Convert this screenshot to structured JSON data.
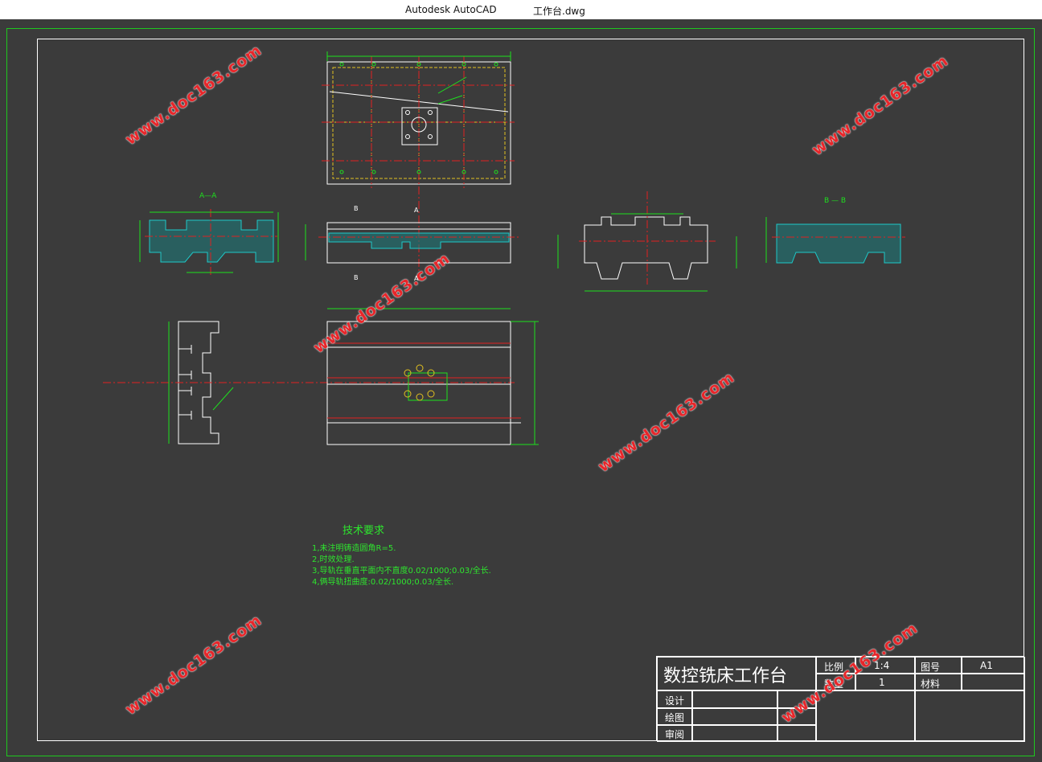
{
  "titlebar": {
    "app_name": "Autodesk AutoCAD",
    "file_name": "工作台.dwg"
  },
  "drawing": {
    "section_labels": {
      "aa": "A—A",
      "bb": "B — B",
      "a": "A",
      "b": "B"
    }
  },
  "technical_requirements": {
    "title": "技术要求",
    "items": [
      "1,未注明铸造圆角R=5.",
      "2,时效处理.",
      "3,导轨在垂直平面内不直度0.02/1000;0.03/全长.",
      "4,俩导轨扭曲度:0.02/1000;0.03/全长."
    ]
  },
  "title_block": {
    "part_name": "数控铣床工作台",
    "scale_label": "比例",
    "scale_value": "1:4",
    "drawing_no_label": "图号",
    "drawing_no_value": "A1",
    "quantity_label": "数量",
    "quantity_value": "1",
    "material_label": "材料",
    "material_value": "",
    "design_label": "设计",
    "draw_label": "绘图",
    "review_label": "审阅"
  },
  "watermark": {
    "text": "www.doc163.com"
  },
  "colors": {
    "background": "#3b3b3b",
    "frame": "#1ec81e",
    "outline": "#ffffff",
    "centerline": "#e02020",
    "dimension": "#1ee01e",
    "hatch": "#1ec8c8",
    "hidden": "#e0c020",
    "watermark": "#e8262a"
  }
}
